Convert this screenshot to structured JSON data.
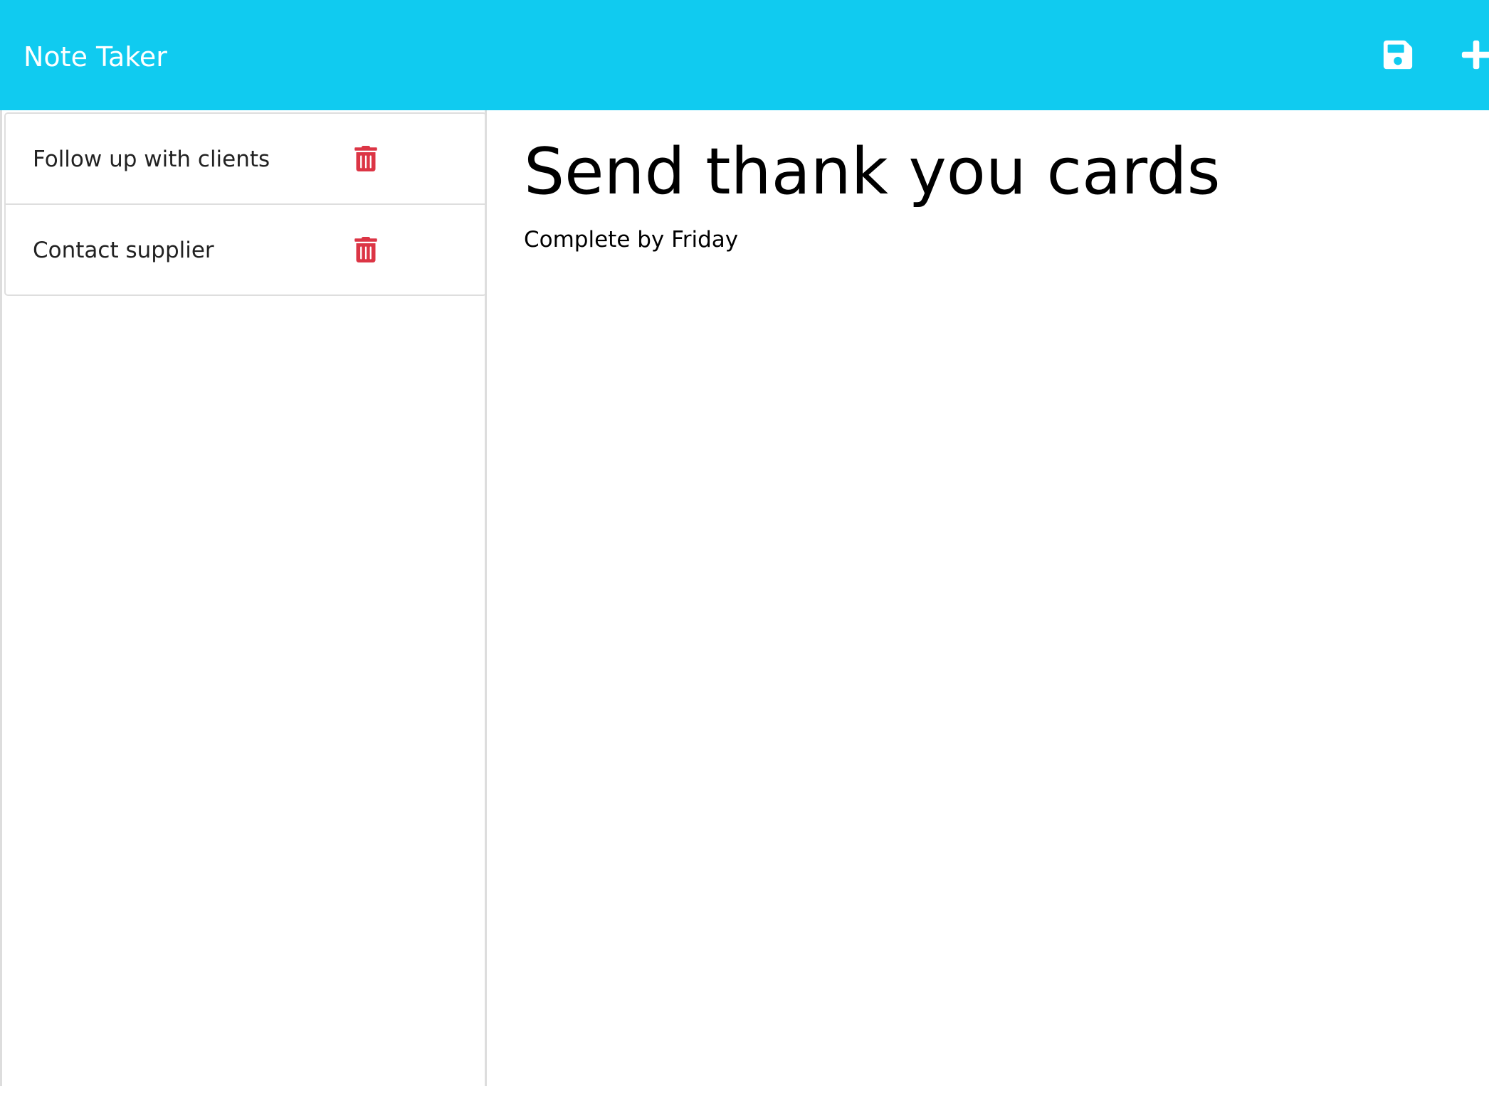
{
  "app": {
    "title": "Note Taker"
  },
  "toolbar": {
    "save_icon": "floppy-disk-icon",
    "new_icon": "plus-icon",
    "icon_color": "#ffffff",
    "bar_color": "#10cbf0"
  },
  "sidebar": {
    "notes": [
      {
        "title": "Follow up with clients",
        "delete_icon": "trash-icon"
      },
      {
        "title": "Contact supplier",
        "delete_icon": "trash-icon"
      }
    ],
    "delete_color": "#dc3545"
  },
  "active_note": {
    "title": "Send thank you cards",
    "text": "Complete by Friday"
  }
}
